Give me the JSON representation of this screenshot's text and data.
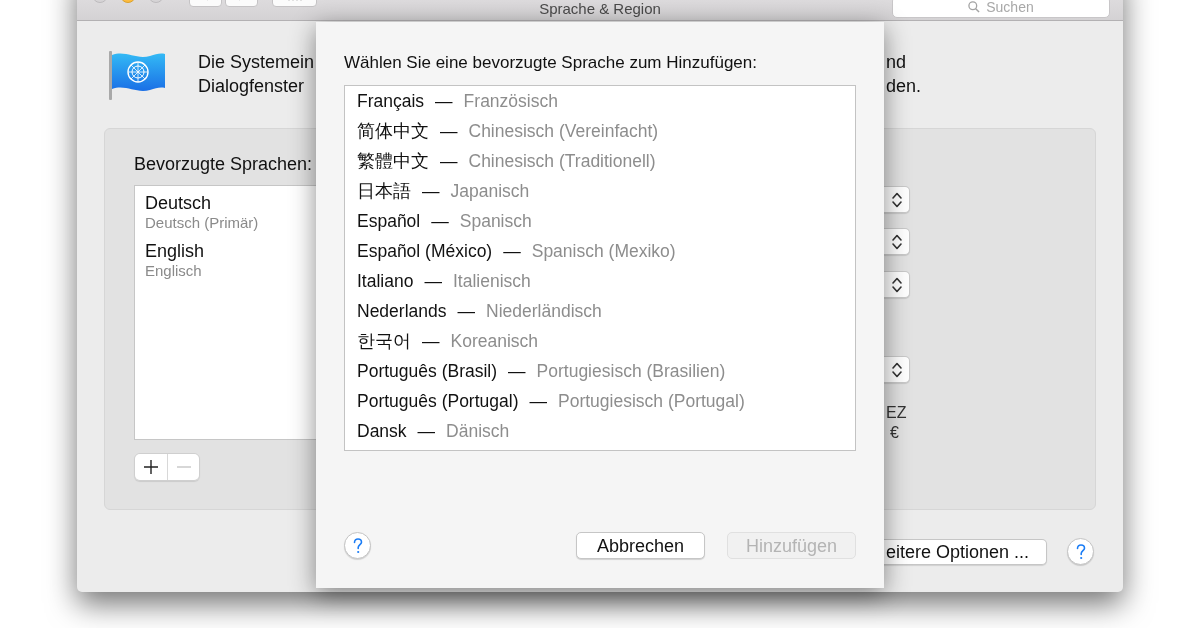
{
  "window": {
    "title": "Sprache & Region",
    "traffic_lights": [
      {
        "kind": "close",
        "disabled": true
      },
      {
        "kind": "minimize",
        "disabled": false
      },
      {
        "kind": "zoom",
        "disabled": true
      }
    ],
    "search": {
      "placeholder": "Suchen"
    }
  },
  "intro_lines": [
    {
      "start": "Die Systemein",
      "end": "nd"
    },
    {
      "start": "Dialogfenster",
      "end": "den."
    }
  ],
  "preferred_languages": {
    "label": "Bevorzugte Sprachen:",
    "items": [
      {
        "name": "Deutsch",
        "detail": "Deutsch (Primär)"
      },
      {
        "name": "English",
        "detail": "Englisch"
      }
    ],
    "list_buttons": [
      {
        "kind": "add",
        "disabled": false
      },
      {
        "kind": "remove",
        "disabled": true
      }
    ]
  },
  "region_values": [
    "EZ",
    "€"
  ],
  "footer": {
    "options_button": "eitere Optionen ..."
  },
  "dialog": {
    "title": "Wählen Sie eine bevorzugte Sprache zum Hinzufügen:",
    "languages": [
      {
        "native": "Français",
        "separator": "—",
        "translation": "Französisch"
      },
      {
        "native": "简体中文",
        "separator": "—",
        "translation": "Chinesisch (Vereinfacht)"
      },
      {
        "native": "繁體中文",
        "separator": "—",
        "translation": "Chinesisch (Traditionell)"
      },
      {
        "native": "日本語",
        "separator": "—",
        "translation": "Japanisch"
      },
      {
        "native": "Español",
        "separator": "—",
        "translation": "Spanisch"
      },
      {
        "native": "Español (México)",
        "separator": "—",
        "translation": "Spanisch (Mexiko)"
      },
      {
        "native": "Italiano",
        "separator": "—",
        "translation": "Italienisch"
      },
      {
        "native": "Nederlands",
        "separator": "—",
        "translation": "Niederländisch"
      },
      {
        "native": "한국어",
        "separator": "—",
        "translation": "Koreanisch"
      },
      {
        "native": "Português (Brasil)",
        "separator": "—",
        "translation": "Portugiesisch (Brasilien)"
      },
      {
        "native": "Português (Portugal)",
        "separator": "—",
        "translation": "Portugiesisch (Portugal)"
      },
      {
        "native": "Dansk",
        "separator": "—",
        "translation": "Dänisch"
      }
    ],
    "buttons": [
      {
        "label": "Abbrechen",
        "disabled": false
      },
      {
        "label": "Hinzufügen",
        "disabled": true
      }
    ]
  }
}
